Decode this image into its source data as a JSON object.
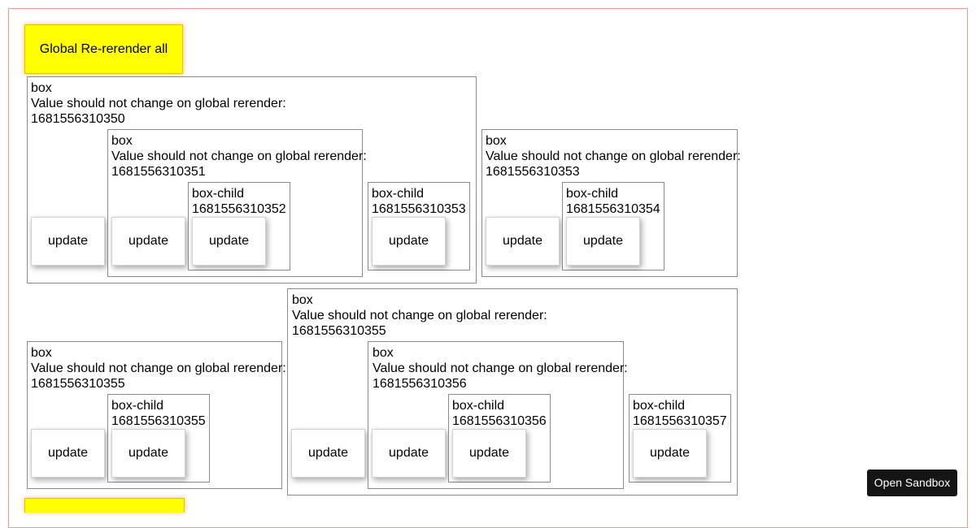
{
  "global_button": {
    "label": "Global Re-rerender all"
  },
  "labels": {
    "box": "box",
    "box_child": "box-child",
    "note": "Value should not change on global rerender:",
    "update": "update"
  },
  "values": {
    "b1": "1681556310350",
    "b2": "1681556310351",
    "c1": "1681556310352",
    "c2": "1681556310353",
    "b3": "1681556310353",
    "c3": "1681556310354",
    "b4": "1681556310355",
    "c4": "1681556310355",
    "b5": "1681556310355",
    "b6": "1681556310356",
    "c5": "1681556310356",
    "c6": "1681556310357"
  },
  "sandbox_button": {
    "label": "Open Sandbox"
  }
}
